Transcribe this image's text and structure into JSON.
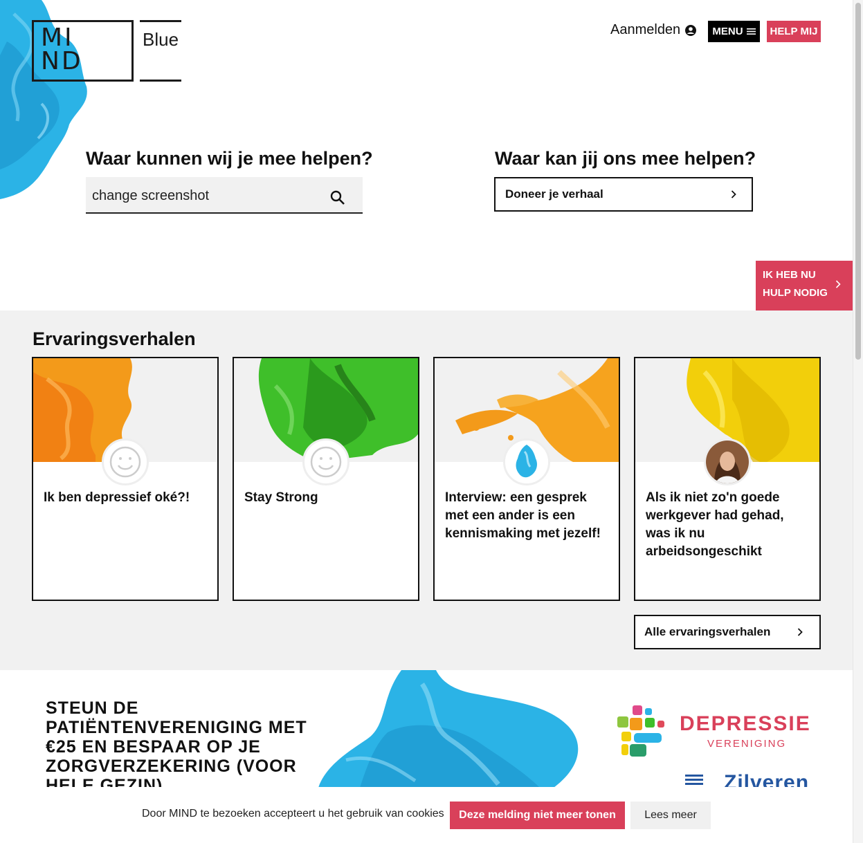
{
  "logo": {
    "mind": "MIND",
    "blue": "Blue"
  },
  "nav": {
    "login_label": "Aanmelden",
    "menu_label": "MENU",
    "help_label": "HELP MIJ"
  },
  "search": {
    "heading": "Waar kunnen wij je mee helpen?",
    "value": "change screenshot"
  },
  "contribute": {
    "heading": "Waar kan jij ons mee helpen?",
    "button_label": "Doneer je verhaal"
  },
  "urgent": {
    "line1": "IK HEB NU",
    "line2": "HULP NODIG"
  },
  "stories": {
    "title": "Ervaringsverhalen",
    "cards": [
      {
        "title": "Ik ben depressief oké?!",
        "color": "#f39a1a",
        "avatar": "smiley-icon"
      },
      {
        "title": "Stay Strong",
        "color": "#3fbf2a",
        "avatar": "smiley-icon"
      },
      {
        "title": "Interview: een gesprek met een ander is een kennismaking met jezelf!",
        "color": "#f6a31e",
        "avatar": "blue-ink-avatar"
      },
      {
        "title": "Als ik niet zo'n goede werkgever had gehad, was ik nu arbeidsongeschikt",
        "color": "#f2cf0b",
        "avatar": "person-photo"
      }
    ],
    "all_label": "Alle ervaringsverhalen"
  },
  "banner": {
    "text": "STEUN DE PATIËNTENVERENIGING MET €25 EN BESPAAR OP JE ZORGVERZEKERING (VOOR HELE GEZIN)",
    "partner_title": "DEPRESSIE",
    "partner_sub": "VERENIGING",
    "insurer": "Zilveren"
  },
  "cookie": {
    "text": "Door MIND te bezoeken accepteert u het gebruik van cookies",
    "hide_label": "Deze melding niet meer tonen",
    "more_label": "Lees meer"
  },
  "colors": {
    "accent": "#d9405a",
    "ink_blue": "#2bb3e6",
    "gray_bg": "#f1f1f1"
  }
}
